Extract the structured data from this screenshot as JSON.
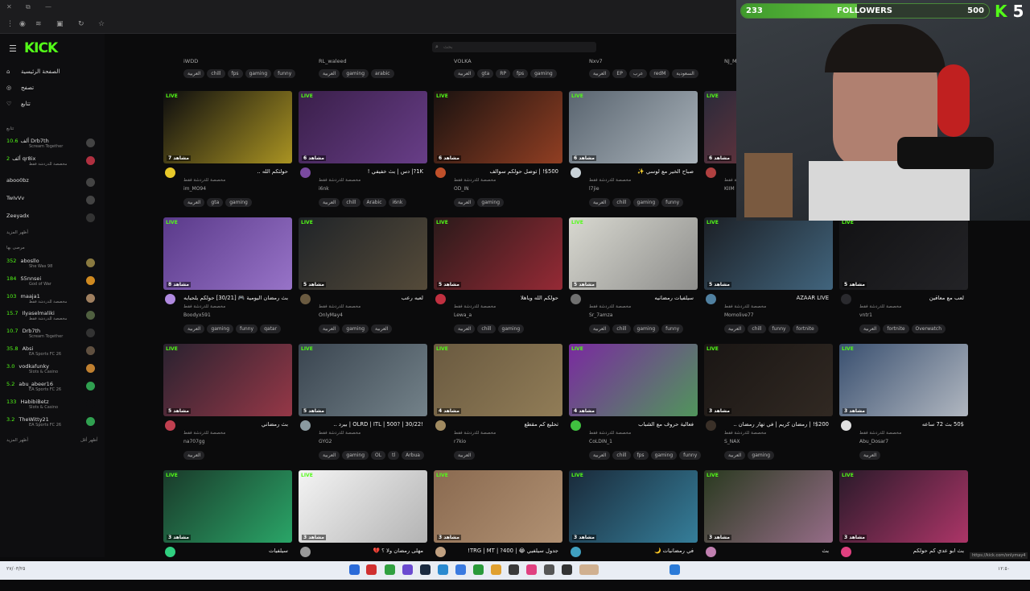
{
  "browser": {
    "url_hint": "https://kick.com/onlymay4"
  },
  "app": {
    "logo": "KICK",
    "search_placeholder": "بحث"
  },
  "sidebar": {
    "nav": [
      {
        "icon": "home-icon",
        "label": "الصفحة الرئيسية"
      },
      {
        "icon": "compass-icon",
        "label": "تصفح"
      },
      {
        "icon": "heart-icon",
        "label": "تتابع"
      }
    ],
    "following_header": "تتابع",
    "following": [
      {
        "viewers": "10.6",
        "unit": "ألف",
        "name": "Drb7th",
        "game": "Scream Together"
      },
      {
        "viewers": "2",
        "unit": "ألف",
        "name": "qr8ix",
        "game": "مخصصة للدردشة فقط"
      },
      {
        "viewers": "",
        "unit": "",
        "name": "aboo0bz",
        "game": ""
      },
      {
        "viewers": "",
        "unit": "",
        "name": "TwIvVv",
        "game": ""
      },
      {
        "viewers": "",
        "unit": "",
        "name": "Zeeyadx",
        "game": ""
      }
    ],
    "show_more_1": "أظهر المزيد",
    "recommended_header": "مرصى بها",
    "recommended": [
      {
        "viewers": "352",
        "name": "abosllo",
        "game": "She Was 98"
      },
      {
        "viewers": "184",
        "name": "S5nnsei",
        "game": "God of War"
      },
      {
        "viewers": "103",
        "name": "maaja1",
        "game": "مخصصة للدردشة فقط"
      },
      {
        "viewers": "15.7",
        "name": "Ilyaselmaliki",
        "game": "مخصصة للدردشة فقط"
      },
      {
        "viewers": "10.7",
        "name": "Drb7th",
        "game": "Scream Together"
      },
      {
        "viewers": "35.8",
        "name": "Absi",
        "game": "EA Sports FC 26"
      },
      {
        "viewers": "3.0",
        "name": "vodkafunky",
        "game": "Slots & Casino"
      },
      {
        "viewers": "5.2",
        "name": "abu_abeer16",
        "game": "EA Sports FC 26"
      },
      {
        "viewers": "133",
        "name": "HabibiBetz",
        "game": "Slots & Casino"
      },
      {
        "viewers": "3.2",
        "name": "TheWitty21",
        "game": "EA Sports FC 26"
      }
    ],
    "show_more_2": "أظهر المزيد",
    "show_less": "أظهر أقل"
  },
  "top_row": [
    {
      "name": "iWDD",
      "tags": [
        "العربية",
        "chill",
        "fps",
        "gaming",
        "funny"
      ]
    },
    {
      "name": "RL_waleed",
      "tags": [
        "العربية",
        "gaming",
        "arabic"
      ]
    },
    {
      "name": "VOLKA",
      "tags": [
        "العربية",
        "gta",
        "RP",
        "fps",
        "gaming"
      ]
    },
    {
      "name": "Nxv7",
      "tags": [
        "العربية",
        "EP",
        "عرب",
        "redM",
        "السعودية"
      ]
    },
    {
      "name": "NJ_M",
      "tags": []
    }
  ],
  "cards": [
    {
      "title": "حولتكم الله ..",
      "name": "im_MO94",
      "cat": "مخصصة للدردشة فقط",
      "viewers": "7 مشاهد",
      "tags": [
        "العربية",
        "gta",
        "gaming"
      ],
      "bg": "#0d0d0f",
      "accent": "#e8c92a"
    },
    {
      "title": "1K?| دس | بث خفيفي !",
      "name": "i6nk",
      "cat": "مخصصة للدردشة فقط",
      "viewers": "6 مشاهد",
      "tags": [
        "العربية",
        "chill",
        "Arabic",
        "i6nk"
      ],
      "bg": "#3a1f4a",
      "accent": "#7a4aa0"
    },
    {
      "title": "$500! | توصل حولكم سوالف",
      "name": "OD_IN",
      "cat": "مخصصة للدردشة فقط",
      "viewers": "6 مشاهد",
      "tags": [
        "العربية",
        "gaming"
      ],
      "bg": "#1a1210",
      "accent": "#c0502a"
    },
    {
      "title": "صباح الخير مع لوسي ✨",
      "name": "l7jie",
      "cat": "مخصصة للدردشة فقط",
      "viewers": "6 مشاهد",
      "tags": [
        "العربية",
        "chill",
        "gaming",
        "funny"
      ],
      "bg": "#5a6570",
      "accent": "#c9d2d8"
    },
    {
      "title": "ولايه",
      "name": "KIIM",
      "cat": "مخصصة للدردشة فقط",
      "viewers": "6 مشاهد",
      "tags": [],
      "bg": "#2a2a3a",
      "accent": "#b04040"
    },
    {
      "title": "بث رمضان اليومية 🎮 [30/21] حولكم يلحيايه",
      "name": "Boodyx591",
      "cat": "مخصصة للدردشة فقط",
      "viewers": "8 مشاهد",
      "tags": [
        "العربية",
        "gaming",
        "funny",
        "qatar"
      ],
      "bg": "#5a3a8a",
      "accent": "#b08ae0"
    },
    {
      "title": "لعبه رعب",
      "name": "OnlyMay4",
      "cat": "مخصصة للدردشة فقط",
      "viewers": "5 مشاهد",
      "tags": [
        "العربية",
        "gaming",
        "العربية"
      ],
      "bg": "#202428",
      "accent": "#6a5a40"
    },
    {
      "title": "حولكم الله وياهلا",
      "name": "Lewa_a",
      "cat": "مخصصة للدردشة فقط",
      "viewers": "5 مشاهد",
      "tags": [
        "العربية",
        "chill",
        "gaming"
      ],
      "bg": "#2a1a1a",
      "accent": "#c03040"
    },
    {
      "title": "سيلفيات رمضانيه",
      "name": "Sr_7amza",
      "cat": "مخصصة للدردشة فقط",
      "viewers": "5 مشاهد",
      "tags": [
        "العربية",
        "chill",
        "gaming",
        "funny"
      ],
      "bg": "#d8d8d0",
      "accent": "#707070"
    },
    {
      "title": "AZAAR LIVE",
      "name": "Momolive77",
      "cat": "مخصصة للدردشة فقط",
      "viewers": "5 مشاهد",
      "tags": [
        "العربية",
        "chill",
        "funny",
        "fortnite"
      ],
      "bg": "#1c2026",
      "accent": "#5080a0"
    },
    {
      "title": "لعب مع معاقين",
      "name": "vntr1",
      "cat": "مخصصة للدردشة فقط",
      "viewers": "5 مشاهد",
      "tags": [
        "العربية",
        "fortnite",
        "Overwatch"
      ],
      "bg": "#121214",
      "accent": "#2a2a2e"
    },
    {
      "title": "بث رمضاني",
      "name": "na707gg",
      "cat": "مخصصة للدردشة فقط",
      "viewers": "5 مشاهد",
      "tags": [
        "العربية"
      ],
      "bg": "#2a2230",
      "accent": "#c04050"
    },
    {
      "title": "!OLRD | ITL | 500? | 30/22 | بيرد ..",
      "name": "GYG2",
      "cat": "مخصصة للدردشة فقط",
      "viewers": "5 مشاهد",
      "tags": [
        "العربية",
        "gaming",
        "OL",
        "tl",
        "Arbua"
      ],
      "bg": "#3a4550",
      "accent": "#8a9aa0"
    },
    {
      "title": "تحليع كم مقطع",
      "name": "r7kio",
      "cat": "مخصصة للدردشة فقط",
      "viewers": "4 مشاهد",
      "tags": [
        "العربية"
      ],
      "bg": "#6a5a40",
      "accent": "#a08a60"
    },
    {
      "title": "فعالية حروف مع الشباب",
      "name": "CoLDIN_1",
      "cat": "مخصصة للدردشة فقط",
      "viewers": "4 مشاهد",
      "tags": [
        "العربية",
        "chill",
        "fps",
        "gaming",
        "funny"
      ],
      "bg": "#7a2aa0",
      "accent": "#40c040"
    },
    {
      "title": "$200! | رمضان كريم | في نهار رمضان ..",
      "name": "S_NAX",
      "cat": "مخصصة للدردشة فقط",
      "viewers": "3 مشاهد",
      "tags": [
        "العربية",
        "gaming"
      ],
      "bg": "#1a1614",
      "accent": "#3a3028"
    },
    {
      "title": "50$ بث 72 ساعه",
      "name": "Abu_Dosar7",
      "cat": "مخصصة للدردشة فقط",
      "viewers": "3 مشاهد",
      "tags": [
        "العربية"
      ],
      "bg": "#3a5070",
      "accent": "#e0e0e0"
    },
    {
      "title": "سيلفيات",
      "name": "",
      "cat": "",
      "viewers": "3 مشاهد",
      "tags": [],
      "bg": "#1a3a2a",
      "accent": "#30d080"
    },
    {
      "title": "مهلى رمضان ولا ؟ 💔",
      "name": "",
      "cat": "",
      "viewers": "3 مشاهد",
      "tags": [],
      "bg": "#f4f4f4",
      "accent": "#999"
    },
    {
      "title": "جدول سيلفيي 😂 | 400? | TRG | MT!",
      "name": "",
      "cat": "",
      "viewers": "3 مشاهد",
      "tags": [],
      "bg": "#8a6a50",
      "accent": "#c0a080"
    },
    {
      "title": "في رمضانيات 🌙",
      "name": "",
      "cat": "",
      "viewers": "3 مشاهد",
      "tags": [],
      "bg": "#1a2a3a",
      "accent": "#40a0c0"
    },
    {
      "title": "بث",
      "name": "",
      "cat": "",
      "viewers": "3 مشاهد",
      "tags": [],
      "bg": "#2a3a20",
      "accent": "#c080b0"
    },
    {
      "title": "بث ابو عدي كم حولكم",
      "name": "",
      "cat": "",
      "viewers": "3 مشاهد",
      "tags": [],
      "bg": "#2a1a2a",
      "accent": "#e04080"
    }
  ],
  "live_label": "LIVE",
  "overlay": {
    "followers_current": "233",
    "followers_label": "FOLLOWERS",
    "followers_goal": "500",
    "progress": 0.466,
    "kick_badge": "5"
  },
  "taskbar": {
    "tray_left": "٢٧/٠٣/٢٥",
    "tray_time": "١٢:٥٠"
  }
}
